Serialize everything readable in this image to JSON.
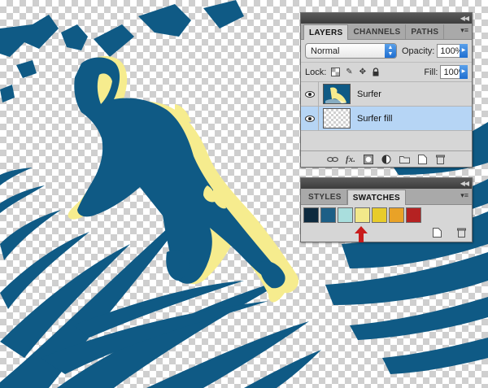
{
  "layers_panel": {
    "tabs": [
      {
        "label": "LAYERS",
        "active": true
      },
      {
        "label": "CHANNELS",
        "active": false
      },
      {
        "label": "PATHS",
        "active": false
      }
    ],
    "blend_mode": "Normal",
    "opacity_label": "Opacity:",
    "opacity_value": "100%",
    "lock_label": "Lock:",
    "fill_label": "Fill:",
    "fill_value": "100%",
    "layers": [
      {
        "name": "Surfer",
        "visible": true,
        "selected": false
      },
      {
        "name": "Surfer fill",
        "visible": true,
        "selected": true
      }
    ],
    "bottom_icons": [
      "link-icon",
      "fx-icon",
      "mask-icon",
      "adjustment-icon",
      "folder-icon",
      "new-layer-icon",
      "trash-icon"
    ],
    "fx_label": "fx."
  },
  "swatches_panel": {
    "tabs": [
      {
        "label": "STYLES",
        "active": false
      },
      {
        "label": "SWATCHES",
        "active": true
      }
    ],
    "swatches": [
      "#0d2a3f",
      "#1d5f86",
      "#a9dedd",
      "#f2e88a",
      "#e8cc2a",
      "#e9a227",
      "#b52222"
    ]
  },
  "colors": {
    "surfer_blue": "#0f5a85",
    "surfer_yellow": "#f6ec8e",
    "arrow_red": "#c81b1b",
    "selection_blue": "#b6d5f5"
  }
}
